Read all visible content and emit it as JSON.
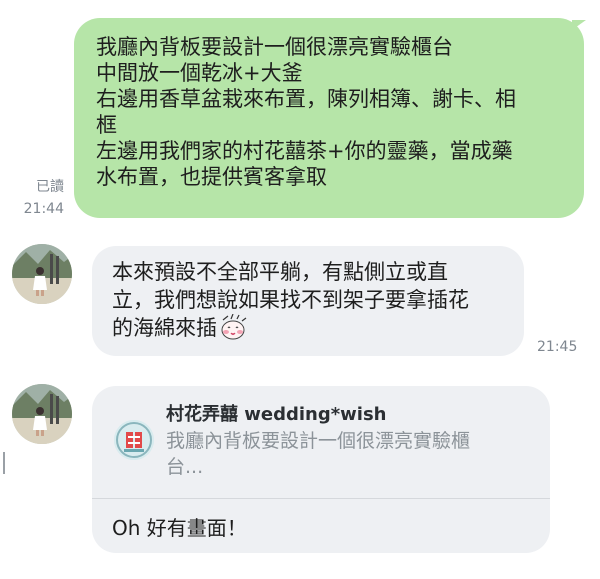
{
  "colors": {
    "sent_bubble": "#b6e5a8",
    "received_bubble": "#eef0f3",
    "meta_text": "#7f8790"
  },
  "messages": {
    "sent": {
      "lines": [
        "我廳內背板要設計一個很漂亮實驗櫃台",
        "中間放一個乾冰+大釜",
        "右邊用香草盆栽來布置，陳列相簿、謝卡、相",
        "框",
        "左邊用我們家的村花囍茶+你的靈藥，當成藥",
        "水布置，也提供賓客拿取"
      ],
      "read_label": "已讀",
      "time": "21:44"
    },
    "received_1": {
      "lines": [
        "本來預設不全部平躺，有點側立或直",
        "立，我們想說如果找不到架子要拿插花",
        "的海綿來插"
      ],
      "sticker_icon": "blushing-face-sticker",
      "time": "21:45"
    },
    "received_2": {
      "reply_to": {
        "sender": "村花弄囍 wedding*wish",
        "preview_lines": [
          "我廳內背板要設計一個很漂亮實驗櫃",
          "台..."
        ]
      },
      "text": "Oh 好有畫面！"
    }
  }
}
